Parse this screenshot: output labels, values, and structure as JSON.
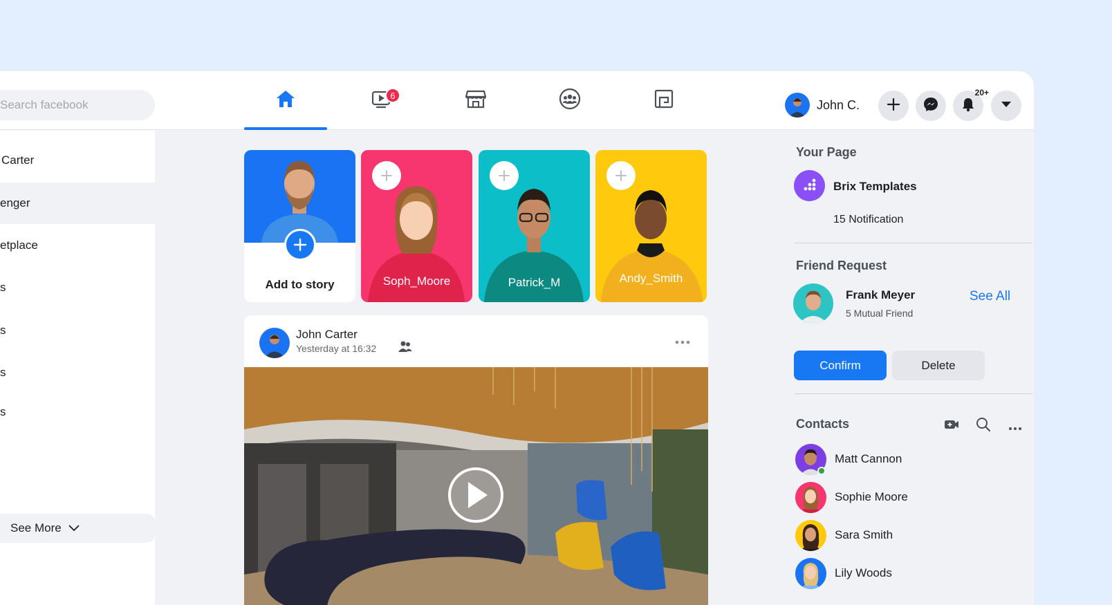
{
  "colors": {
    "accent": "#1877f2",
    "badge": "#f02849",
    "online": "#31a24c",
    "background": "#e3efff"
  },
  "header": {
    "search_placeholder": "Search facebook",
    "nav_tabs": [
      {
        "name": "home",
        "icon": "home-icon",
        "active": true
      },
      {
        "name": "watch",
        "icon": "video-icon",
        "badge": "6"
      },
      {
        "name": "marketplace",
        "icon": "store-icon"
      },
      {
        "name": "groups",
        "icon": "groups-icon"
      },
      {
        "name": "gaming",
        "icon": "gaming-icon"
      }
    ],
    "user_name": "John C.",
    "notifications_count": "20+"
  },
  "sidebar": {
    "items": [
      {
        "label": "Carter",
        "icon": "user-icon"
      },
      {
        "label": "enger",
        "icon": "messenger-icon"
      },
      {
        "label": "etplace",
        "icon": "marketplace-icon"
      },
      {
        "label": "s",
        "icon": "groups-icon"
      },
      {
        "label": "s",
        "icon": "watch-icon"
      },
      {
        "label": "s",
        "icon": "events-icon"
      },
      {
        "label": "s",
        "icon": "memories-icon"
      }
    ],
    "see_more_label": "See More"
  },
  "stories": {
    "add_label": "Add to story",
    "items": [
      {
        "name": "Soph_Moore",
        "color": "#f7356f"
      },
      {
        "name": "Patrick_M",
        "color": "#0bbec7"
      },
      {
        "name": "Andy_Smith",
        "color": "#ffc90e"
      }
    ]
  },
  "post": {
    "author": "John Carter",
    "time": "Yesterday at 16:32",
    "audience_icon": "friends-icon",
    "media": "office-lobby-video"
  },
  "right": {
    "your_page_title": "Your Page",
    "page_name": "Brix Templates",
    "page_notifications": "15 Notification",
    "friend_request_title": "Friend Request",
    "see_all_label": "See All",
    "request_name": "Frank Meyer",
    "request_mutual": "5 Mutual Friend",
    "confirm_label": "Confirm",
    "delete_label": "Delete",
    "contacts_title": "Contacts",
    "contacts": [
      {
        "name": "Matt Cannon",
        "online": true,
        "color": "#7b3fe4"
      },
      {
        "name": "Sophie Moore",
        "online": false,
        "color": "#f7356f"
      },
      {
        "name": "Sara Smith",
        "online": false,
        "color": "#ffc90e"
      },
      {
        "name": "Lily Woods",
        "online": false,
        "color": "#1a73f2"
      }
    ]
  }
}
